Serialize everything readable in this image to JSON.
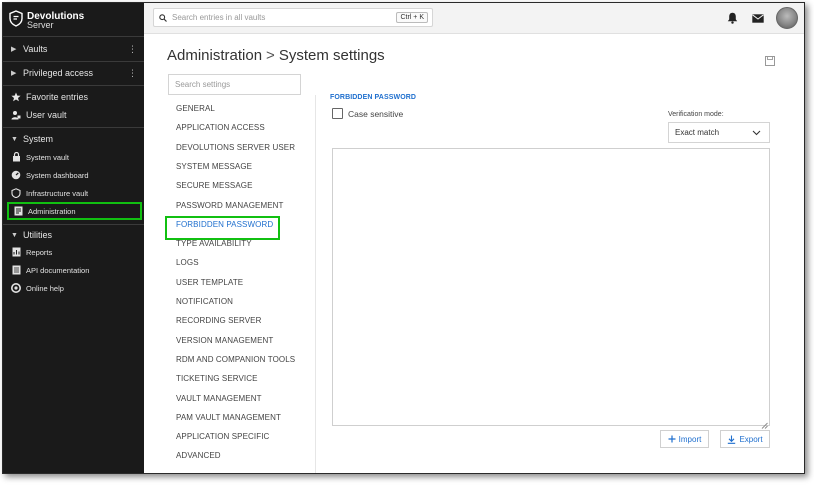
{
  "app": {
    "brand_line1": "Devolutions",
    "brand_line2": "Server",
    "logo_icon": "shield-logo-icon"
  },
  "sidebar": {
    "groups": [
      {
        "label": "Vaults",
        "icon": "chevron-right-icon"
      },
      {
        "label": "Privileged access",
        "icon": "chevron-right-icon"
      }
    ],
    "quick": [
      {
        "label": "Favorite entries",
        "icon": "star-icon"
      },
      {
        "label": "User vault",
        "icon": "user-lock-icon"
      }
    ],
    "system": {
      "label": "System",
      "items": [
        {
          "label": "System vault",
          "icon": "lock-icon"
        },
        {
          "label": "System dashboard",
          "icon": "dashboard-icon"
        },
        {
          "label": "Infrastructure vault",
          "icon": "infrastructure-icon"
        },
        {
          "label": "Administration",
          "icon": "admin-icon"
        }
      ]
    },
    "utilities": {
      "label": "Utilities",
      "items": [
        {
          "label": "Reports",
          "icon": "report-icon"
        },
        {
          "label": "API documentation",
          "icon": "document-icon"
        },
        {
          "label": "Online help",
          "icon": "help-icon"
        }
      ]
    }
  },
  "topbar": {
    "search_placeholder": "Search entries in all vaults",
    "shortcut": "Ctrl + K",
    "icons": [
      "bell-icon",
      "mail-icon",
      "avatar"
    ]
  },
  "page": {
    "breadcrumb_root": "Administration",
    "breadcrumb_sep": ">",
    "title": "System settings"
  },
  "settings": {
    "search_placeholder": "Search settings",
    "items": [
      "GENERAL",
      "APPLICATION ACCESS",
      "DEVOLUTIONS SERVER USER",
      "SYSTEM MESSAGE",
      "SECURE MESSAGE",
      "PASSWORD MANAGEMENT",
      "FORBIDDEN PASSWORD",
      "TYPE AVAILABILITY",
      "LOGS",
      "USER TEMPLATE",
      "NOTIFICATION",
      "RECORDING SERVER",
      "VERSION MANAGEMENT",
      "RDM AND COMPANION TOOLS",
      "TICKETING SERVICE",
      "VAULT MANAGEMENT",
      "PAM VAULT MANAGEMENT",
      "APPLICATION SPECIFIC",
      "ADVANCED"
    ],
    "active_index": 6
  },
  "panel": {
    "section_title": "FORBIDDEN PASSWORD",
    "case_sensitive_label": "Case sensitive",
    "case_sensitive_checked": false,
    "verification_mode_label": "Verification mode:",
    "verification_mode_value": "Exact match",
    "textarea_value": "",
    "import_label": "Import",
    "export_label": "Export"
  },
  "colors": {
    "sidebar_bg": "#1a1a1a",
    "accent": "#1f6fce",
    "highlight": "#11c011"
  }
}
